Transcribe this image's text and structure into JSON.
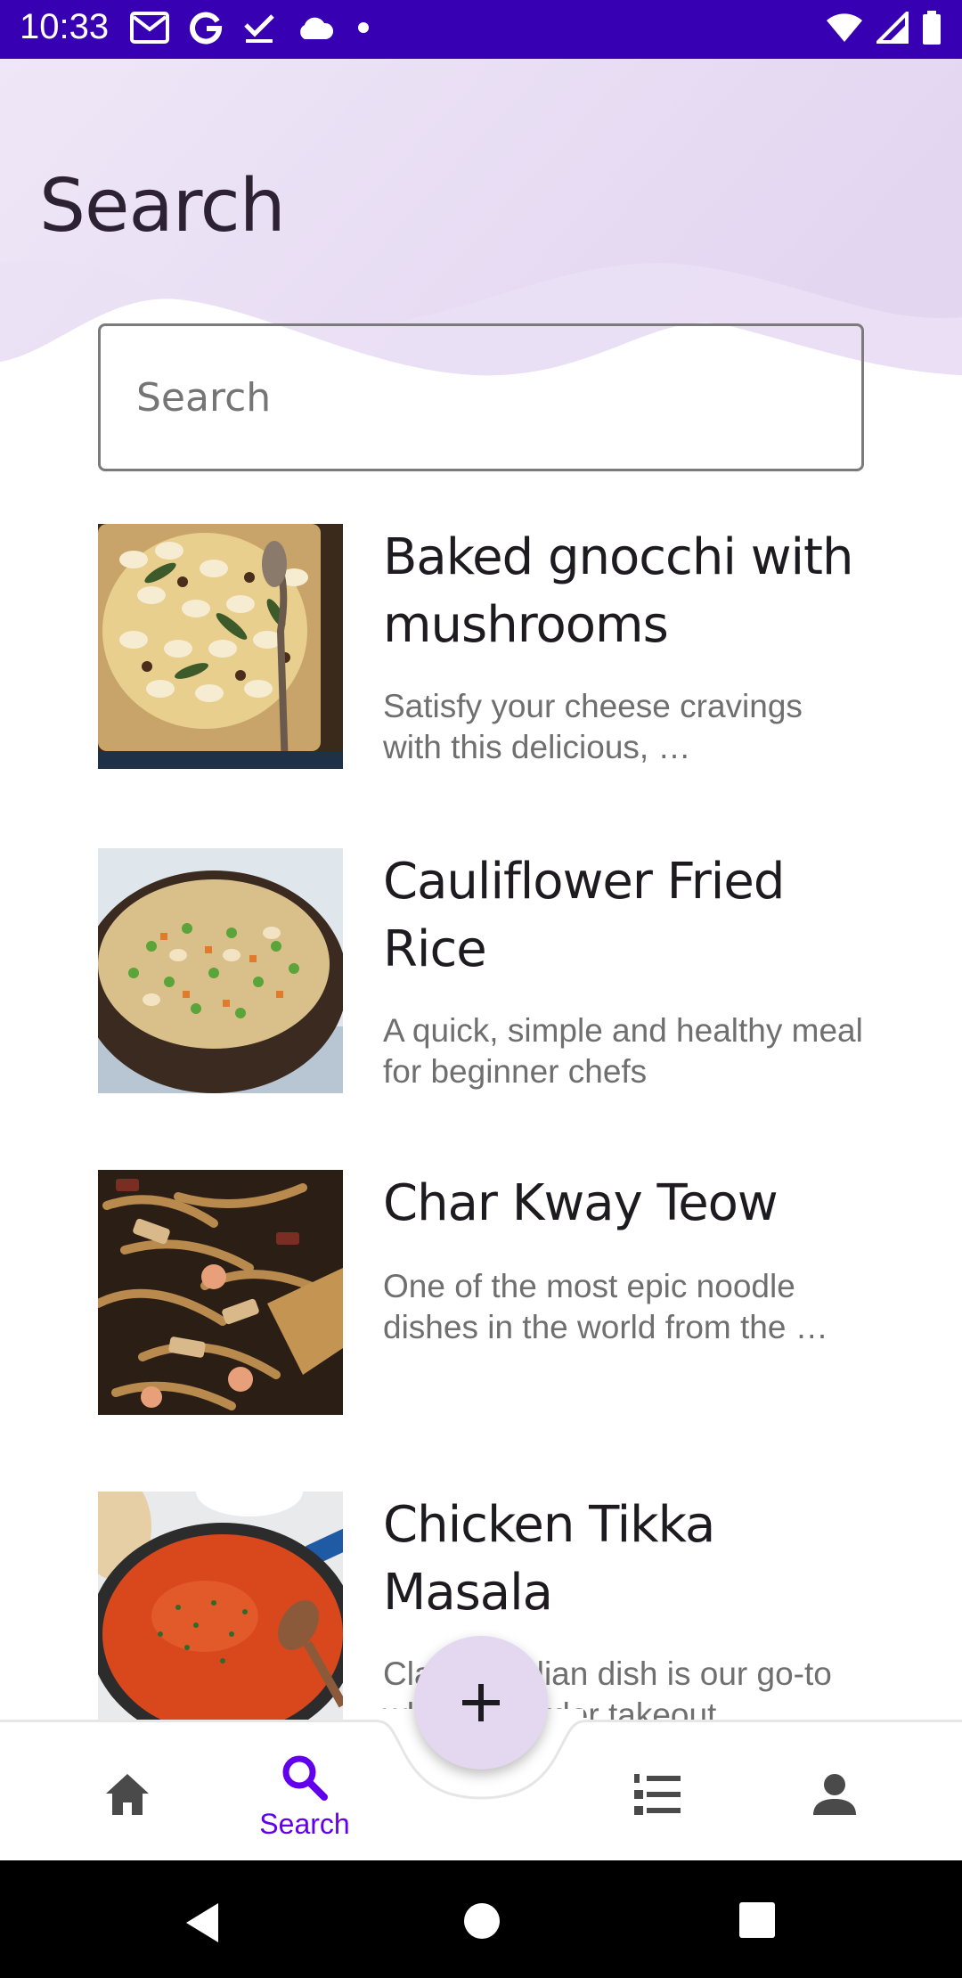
{
  "status_bar": {
    "time": "10:33",
    "left_icons": [
      "gmail-icon",
      "google-icon",
      "tasks-check-icon",
      "cloud-icon",
      "dot-icon"
    ],
    "right_icons": [
      "wifi-icon",
      "signal-icon",
      "battery-icon"
    ]
  },
  "header": {
    "title": "Search"
  },
  "search": {
    "placeholder": "Search",
    "value": ""
  },
  "recipes": [
    {
      "title": "Baked gnocchi with mushrooms",
      "description": "Satisfy your cheese cravings with this delicious, …",
      "image": "baked-gnocchi-image"
    },
    {
      "title": "Cauliflower Fried Rice",
      "description": "A quick, simple and healthy meal for beginner chefs",
      "image": "cauliflower-fried-rice-image"
    },
    {
      "title": "Char Kway Teow",
      "description": "One of the most epic noodle dishes in the world from the …",
      "image": "char-kway-teow-image"
    },
    {
      "title": "Chicken Tikka Masala",
      "description": "Classic Indian dish is our go-to when we order takeout",
      "image": "chicken-tikka-masala-image"
    }
  ],
  "bottom_nav": {
    "items": [
      {
        "icon": "home-icon",
        "label": "",
        "active": false
      },
      {
        "icon": "search-icon",
        "label": "Search",
        "active": true
      },
      {
        "icon": "numbered-list-icon",
        "label": "",
        "active": false
      },
      {
        "icon": "person-icon",
        "label": "",
        "active": false
      }
    ],
    "fab_icon": "plus-icon"
  },
  "system_nav": {
    "buttons": [
      "back-icon",
      "home-circle-icon",
      "recents-icon"
    ]
  },
  "colors": {
    "status_bar": "#3700b3",
    "accent": "#6200ee",
    "header_wave": "#e9dff3",
    "fab": "#e4d7f0",
    "title_text": "#2c2233",
    "description_text": "#6f6f6f"
  }
}
